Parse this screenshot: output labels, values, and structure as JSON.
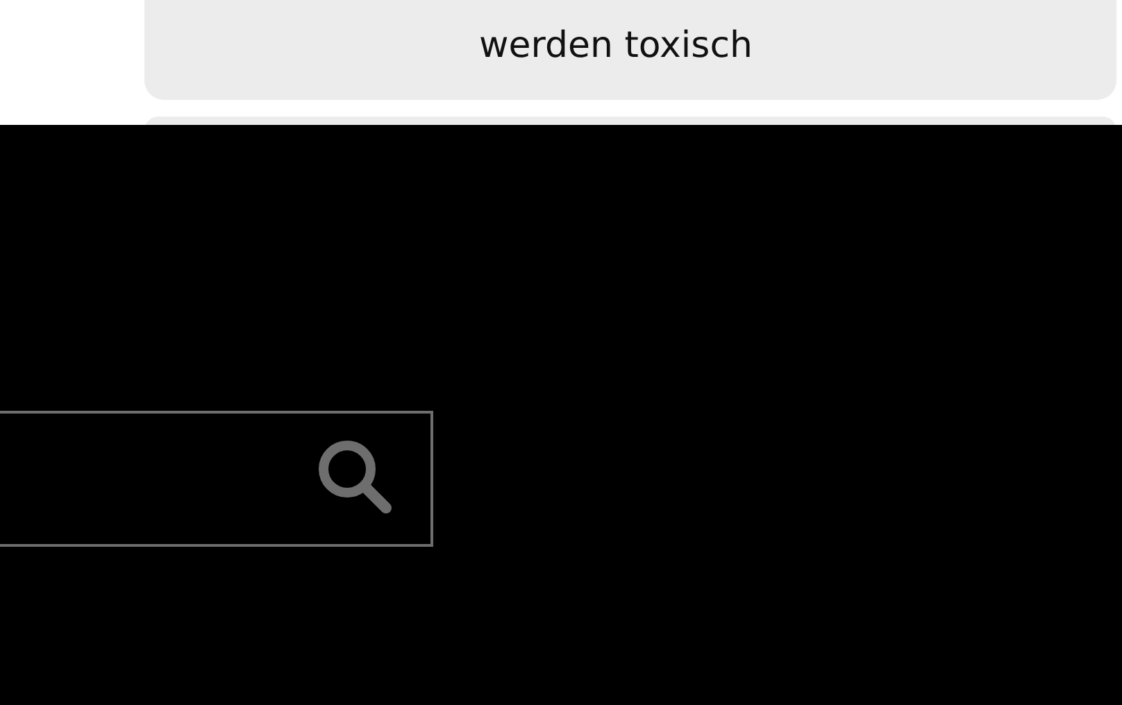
{
  "cards": [
    {
      "text": "werden toxisch"
    }
  ]
}
